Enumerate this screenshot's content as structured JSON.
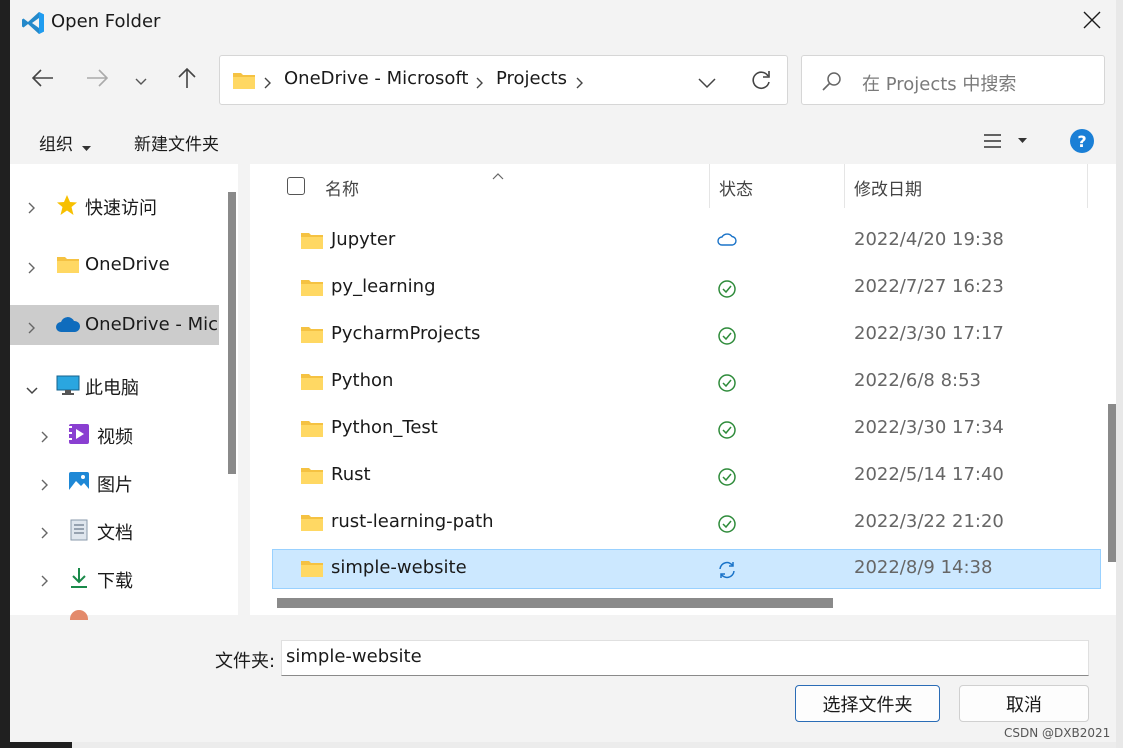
{
  "window": {
    "title": "Open Folder",
    "app_icon": "vscode-icon",
    "close_icon": "close-icon"
  },
  "navigation": {
    "back_icon": "arrow-left-icon",
    "forward_icon": "arrow-right-icon",
    "recent_icon": "chevron-down-icon",
    "up_icon": "arrow-up-icon"
  },
  "address_bar": {
    "segments": [
      "OneDrive - Microsoft",
      "Projects"
    ],
    "dropdown_icon": "chevron-down-icon",
    "refresh_icon": "refresh-icon"
  },
  "search": {
    "placeholder": "在 Projects 中搜索",
    "icon": "search-icon"
  },
  "toolbar": {
    "organize_label": "组织",
    "new_folder_label": "新建文件夹",
    "view_icon": "list-view-icon",
    "help_label": "?"
  },
  "nav_pane": {
    "items": [
      {
        "label": "快速访问",
        "icon": "star-icon",
        "expanded": false
      },
      {
        "label": "OneDrive",
        "icon": "folder-icon",
        "expanded": false
      },
      {
        "label": "OneDrive - Microsoft",
        "icon": "cloud-icon",
        "expanded": false,
        "selected": true
      },
      {
        "label": "此电脑",
        "icon": "computer-icon",
        "expanded": true
      },
      {
        "label": "视频",
        "icon": "video-icon",
        "expanded": false
      },
      {
        "label": "图片",
        "icon": "picture-icon",
        "expanded": false
      },
      {
        "label": "文档",
        "icon": "document-icon",
        "expanded": false
      },
      {
        "label": "下载",
        "icon": "download-icon",
        "expanded": false
      }
    ]
  },
  "file_list": {
    "columns": {
      "name": "名称",
      "status": "状态",
      "modified": "修改日期"
    },
    "rows": [
      {
        "name": "Jupyter",
        "status": "cloud",
        "modified": "2022/4/20 19:38"
      },
      {
        "name": "py_learning",
        "status": "available",
        "modified": "2022/7/27 16:23"
      },
      {
        "name": "PycharmProjects",
        "status": "available",
        "modified": "2022/3/30 17:17"
      },
      {
        "name": "Python",
        "status": "available",
        "modified": "2022/6/8 8:53"
      },
      {
        "name": "Python_Test",
        "status": "available",
        "modified": "2022/3/30 17:34"
      },
      {
        "name": "Rust",
        "status": "available",
        "modified": "2022/5/14 17:40"
      },
      {
        "name": "rust-learning-path",
        "status": "available",
        "modified": "2022/3/22 21:20"
      },
      {
        "name": "simple-website",
        "status": "syncing",
        "modified": "2022/8/9 14:38",
        "selected": true
      }
    ]
  },
  "footer": {
    "folder_label": "文件夹:",
    "folder_value": "simple-website",
    "select_button": "选择文件夹",
    "cancel_button": "取消"
  },
  "watermark": "CSDN @DXB2021",
  "colors": {
    "accent": "#1a7fd6",
    "selected_row": "#cce8ff",
    "status_ok": "#2e8b3a",
    "folder": "#f5c242"
  }
}
